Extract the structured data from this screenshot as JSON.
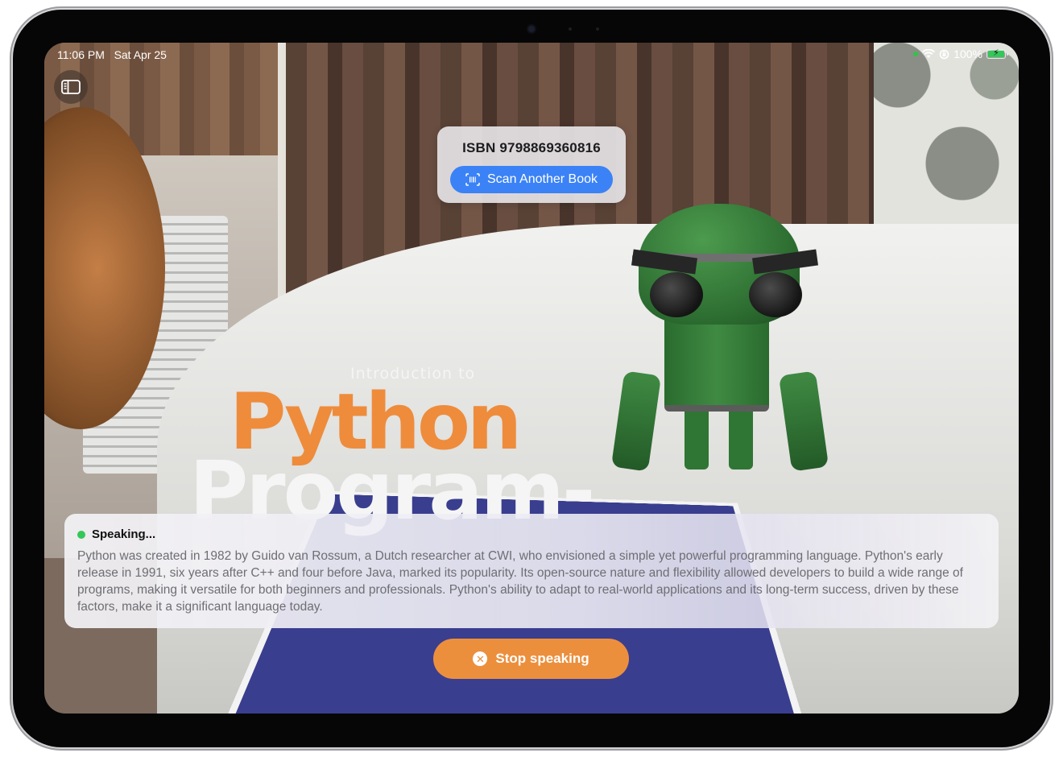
{
  "status_bar": {
    "time": "11:06 PM",
    "date": "Sat Apr 25",
    "battery": "100%",
    "icons": [
      "wifi-icon",
      "orientation-lock-icon",
      "battery-charging-icon"
    ]
  },
  "sidebar_toggle": {
    "icon": "sidebar-icon"
  },
  "scan_card": {
    "isbn": "ISBN 9798869360816",
    "scan_button_label": "Scan Another Book",
    "scan_button_icon": "barcode-viewfinder-icon"
  },
  "book_cover": {
    "line1": "Introduction to",
    "line2": "Python",
    "line3": "Program-"
  },
  "speaking": {
    "status": "Speaking...",
    "text": "Python was created in 1982 by Guido van Rossum, a Dutch researcher at CWI, who envisioned a simple yet powerful programming language. Python's early release in 1991, six years after C++ and four before Java, marked its popularity. Its open-source nature and flexibility allowed developers to build a wide range of programs, making it versatile for both beginners and professionals. Python's ability to adapt to real-world applications and its long-term success, driven by these factors, make it a significant language today."
  },
  "stop_button": {
    "label": "Stop speaking",
    "icon": "close-circle-icon"
  },
  "colors": {
    "accent_blue": "#3b82f6",
    "accent_orange": "#ec8f3d",
    "status_green": "#34c759"
  }
}
